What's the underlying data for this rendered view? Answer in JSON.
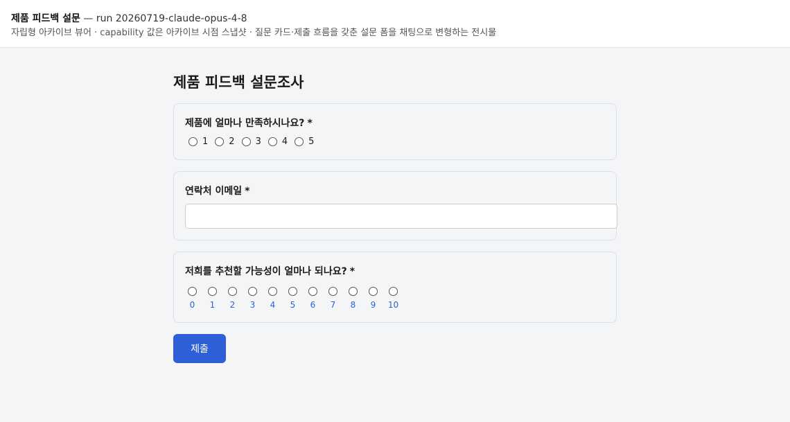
{
  "header": {
    "title": "제품 피드백 설문",
    "run": " — run 20260719-claude-opus-4-8",
    "subtitle": "자립형 아카이브 뷰어 · capability 값은 아카이브 시점 스냅샷 · 질문 카드·제출 흐름을 갖춘 설문 폼을 채팅으로 변형하는 전시물"
  },
  "form": {
    "title": "제품 피드백 설문조사",
    "questions": [
      {
        "label": "제품에 얼마나 만족하시나요?",
        "required": "*",
        "options": [
          "1",
          "2",
          "3",
          "4",
          "5"
        ]
      },
      {
        "label": "연락처 이메일",
        "required": "*",
        "value": "",
        "placeholder": ""
      },
      {
        "label": "저희를 추천할 가능성이 얼마나 되나요?",
        "required": "*",
        "options": [
          "0",
          "1",
          "2",
          "3",
          "4",
          "5",
          "6",
          "7",
          "8",
          "9",
          "10"
        ]
      }
    ],
    "submit_label": "제출"
  },
  "colors": {
    "accent": "#2d5fd6",
    "background": "#f4f5f7",
    "card_border": "#dcdfe4"
  },
  "icons": {
    "radio": "radio-unchecked-icon"
  }
}
